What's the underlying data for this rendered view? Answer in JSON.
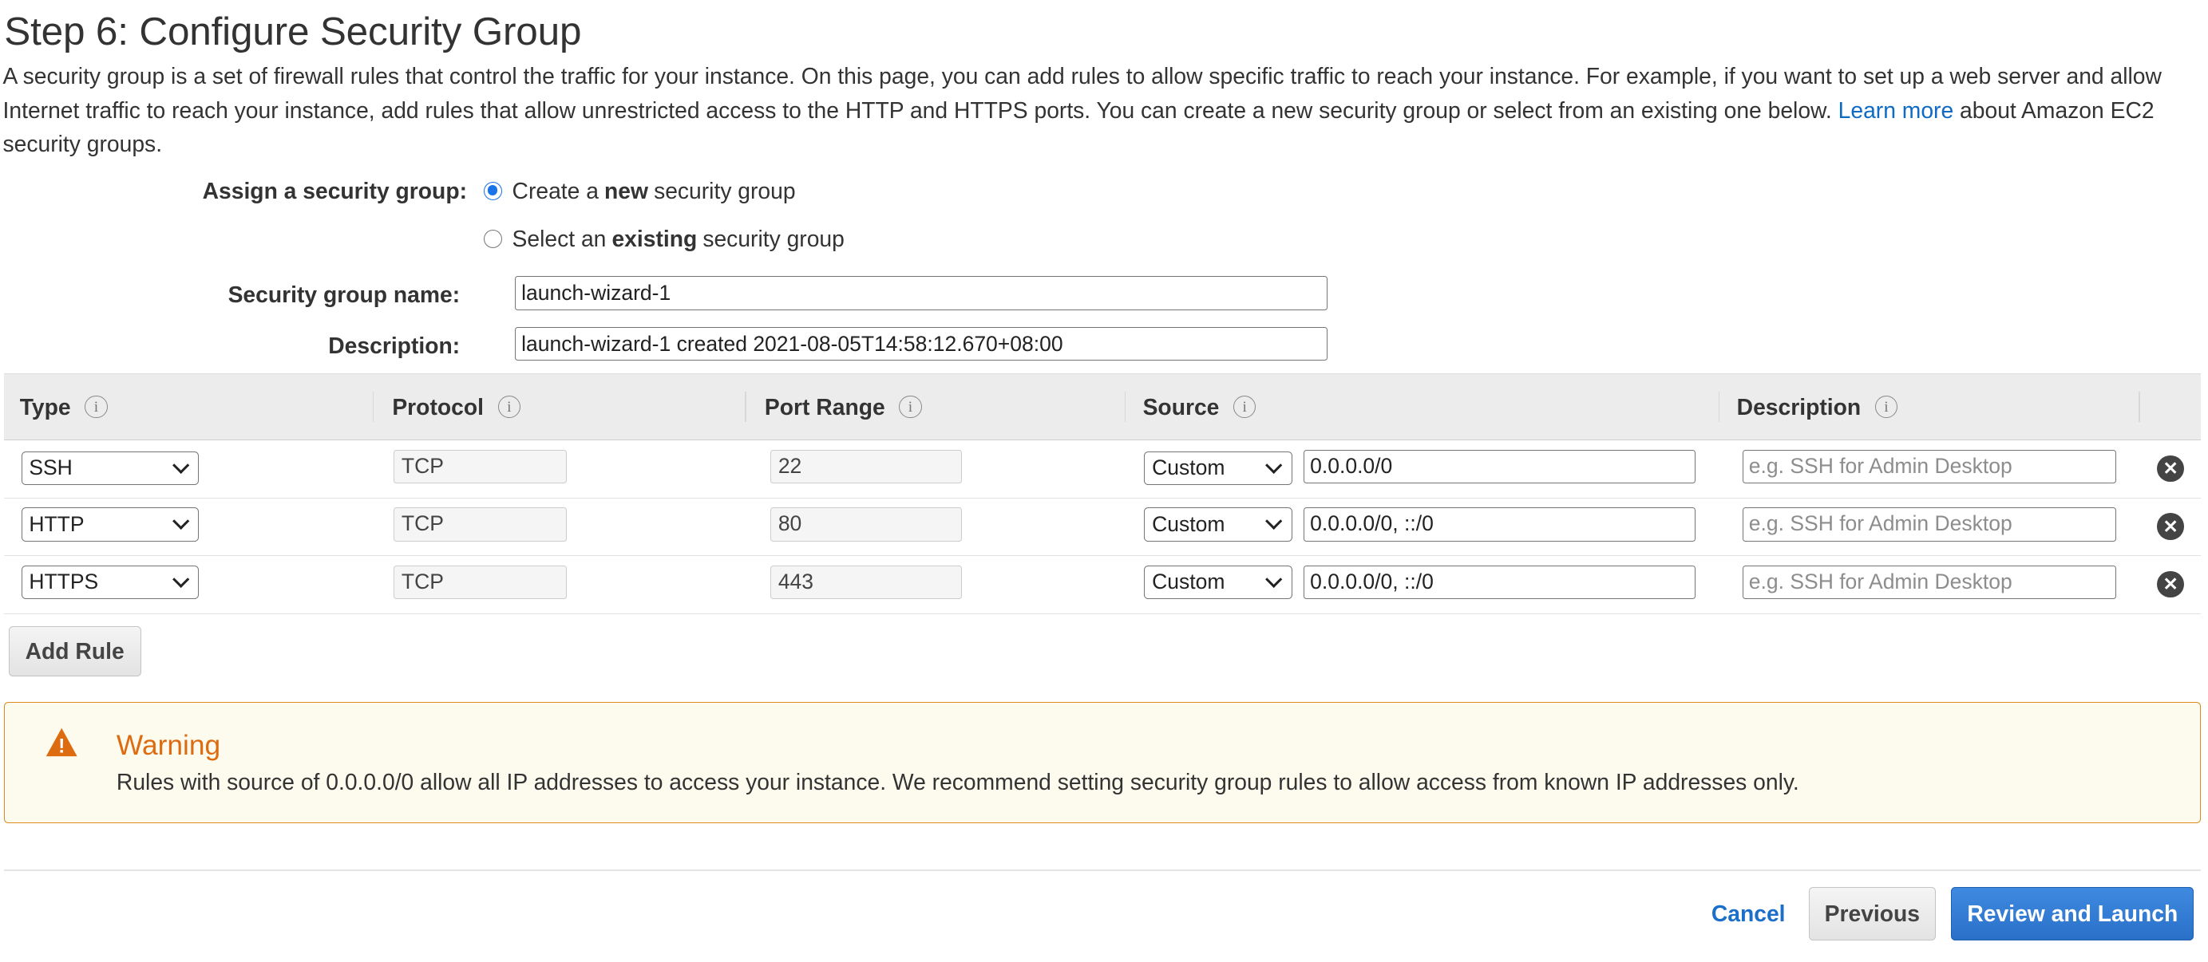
{
  "page": {
    "title": "Step 6: Configure Security Group",
    "intro_text": "A security group is a set of firewall rules that control the traffic for your instance. On this page, you can add rules to allow specific traffic to reach your instance. For example, if you want to set up a web server and allow Internet traffic to reach your instance, add rules that allow unrestricted access to the HTTP and HTTPS ports. You can create a new security group or select from an existing one below.",
    "learn_more_link": "Learn more",
    "intro_tail": "about Amazon EC2 security groups."
  },
  "assign": {
    "label": "Assign a security group:",
    "option_new": {
      "pre": "Create a ",
      "bold": "new",
      "post": " security group",
      "checked": true
    },
    "option_existing": {
      "pre": "Select an ",
      "bold": "existing",
      "post": " security group",
      "checked": false
    }
  },
  "form": {
    "name_label": "Security group name:",
    "name_value": "launch-wizard-1",
    "description_label": "Description:",
    "description_value": "launch-wizard-1 created 2021-08-05T14:58:12.670+08:00"
  },
  "table": {
    "headers": {
      "type": "Type",
      "protocol": "Protocol",
      "port_range": "Port Range",
      "source": "Source",
      "description": "Description"
    },
    "info_glyph": "i",
    "description_placeholder": "e.g. SSH for Admin Desktop",
    "rows": [
      {
        "type": "SSH",
        "protocol": "TCP",
        "port": "22",
        "source_mode": "Custom",
        "source_value": "0.0.0.0/0"
      },
      {
        "type": "HTTP",
        "protocol": "TCP",
        "port": "80",
        "source_mode": "Custom",
        "source_value": "0.0.0.0/0, ::/0"
      },
      {
        "type": "HTTPS",
        "protocol": "TCP",
        "port": "443",
        "source_mode": "Custom",
        "source_value": "0.0.0.0/0, ::/0"
      }
    ],
    "remove_glyph": "✕"
  },
  "add_rule_label": "Add Rule",
  "warning": {
    "icon_glyph": "!",
    "title": "Warning",
    "text": "Rules with source of 0.0.0.0/0 allow all IP addresses to access your instance. We recommend setting security group rules to allow access from known IP addresses only.",
    "border_color": "#dd8a1e",
    "title_color": "#dd6b10"
  },
  "footer": {
    "cancel_label": "Cancel",
    "previous_label": "Previous",
    "review_label": "Review and Launch"
  },
  "colors": {
    "accent_blue": "#2a70c8",
    "link_blue": "#0e6bc4"
  }
}
